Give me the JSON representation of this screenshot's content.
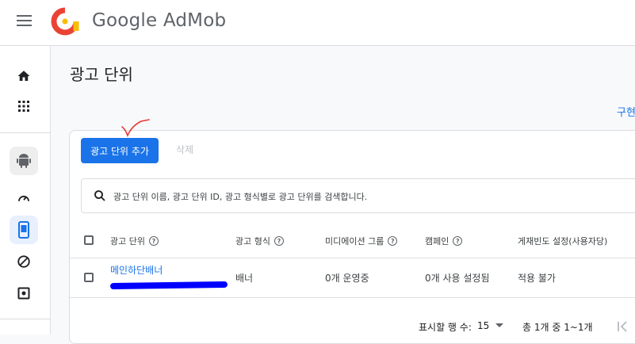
{
  "app": {
    "brand": "Google AdMob"
  },
  "page": {
    "title": "광고 단위",
    "impl_link": "구현"
  },
  "toolbar": {
    "add_label": "광고 단위 추가",
    "delete_label": "삭제"
  },
  "search": {
    "placeholder": "광고 단위 이름, 광고 단위 ID, 광고 형식별로 광고 단위를 검색합니다."
  },
  "table": {
    "columns": [
      "광고 단위",
      "광고 형식",
      "미디에이션 그룹",
      "캠페인",
      "게재빈도 설정(사용자당)"
    ],
    "rows": [
      {
        "name": "메인하단배너",
        "format": "배너",
        "mediation": "0개 운영중",
        "campaign": "0개 사용 설정됨",
        "frequency": "적용 불가"
      }
    ]
  },
  "pagination": {
    "rows_label": "표시할 행 수:",
    "rows_value": "15",
    "range": "총 1개 중 1~1개"
  },
  "colors": {
    "accent": "#1a73e8",
    "annotation": "#e53935",
    "redaction": "#0000ff"
  },
  "icons": [
    "menu-icon",
    "admob-logo",
    "home-icon",
    "apps-grid-icon",
    "android-icon",
    "dashboard-gauge-icon",
    "ad-units-icon",
    "block-icon",
    "settings-icon",
    "search-icon",
    "help-icon",
    "dropdown-icon",
    "first-page-icon"
  ]
}
